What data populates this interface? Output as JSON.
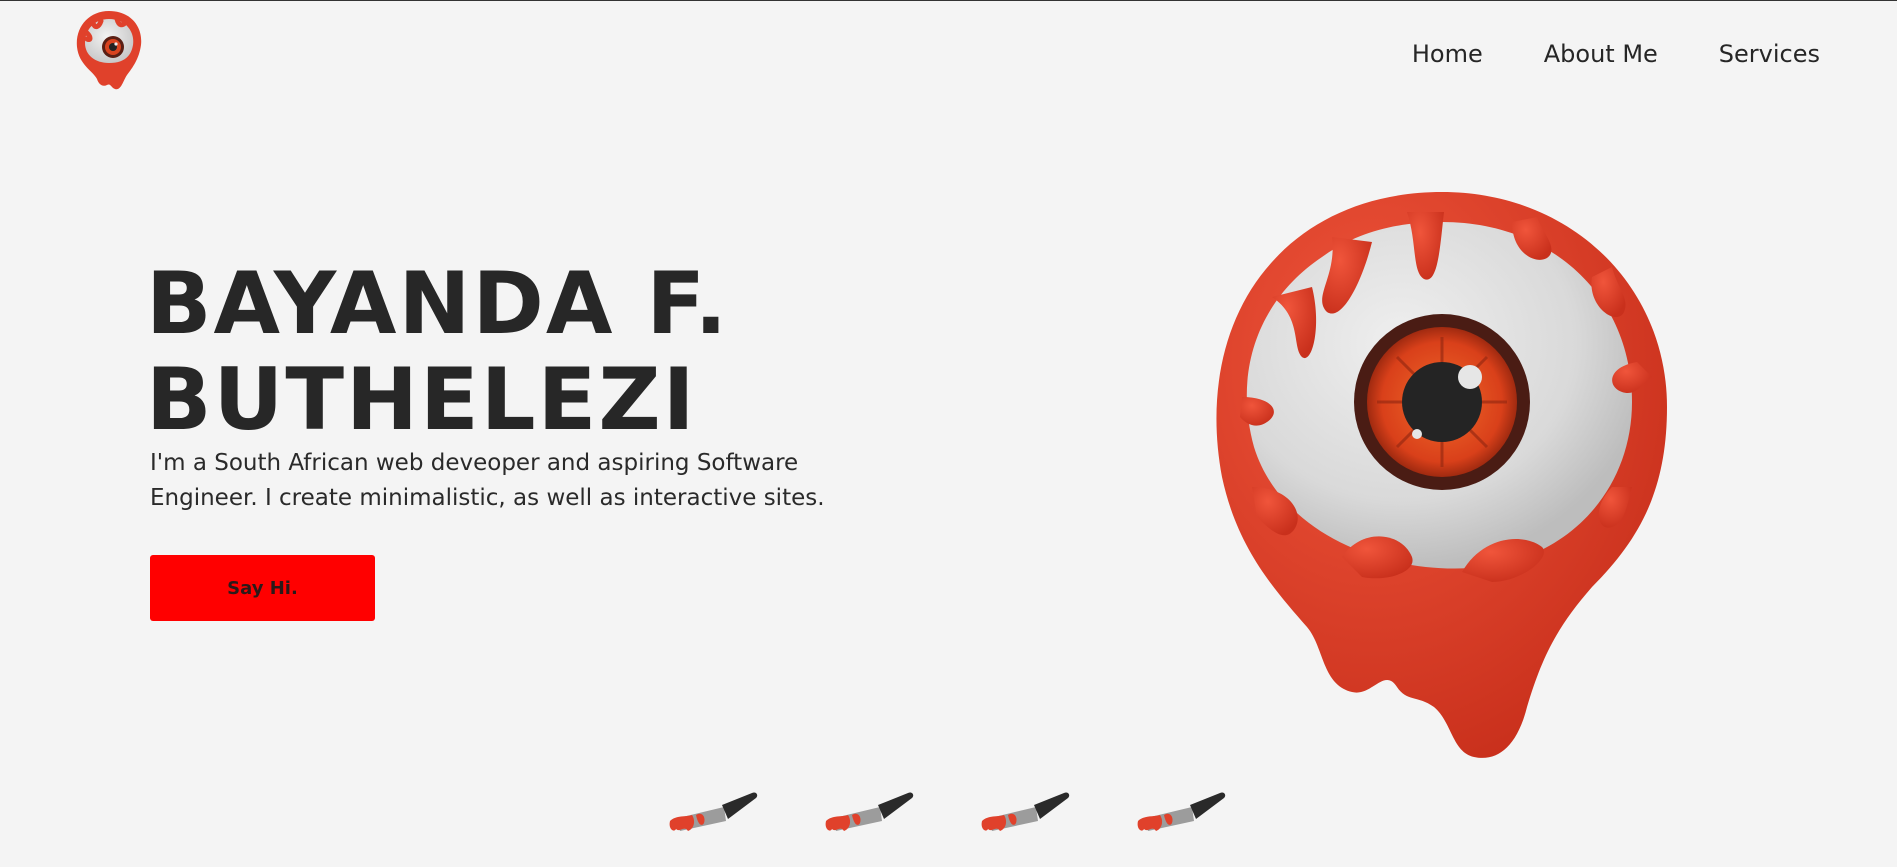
{
  "header": {
    "logo_icon": "bloody-eyeball-icon",
    "nav": [
      {
        "label": "Home"
      },
      {
        "label": "About Me"
      },
      {
        "label": "Services"
      }
    ]
  },
  "hero": {
    "title_line1": "BAYANDA F.",
    "title_line2": "BUTHELEZI",
    "description": "I'm a South African web deveoper and aspiring Software Engineer. I create minimalistic, as well as interactive sites.",
    "cta_label": "Say Hi.",
    "illustration_icon": "bloody-eyeball-icon"
  },
  "decorations": {
    "knife_icon": "bloody-knife-icon"
  },
  "colors": {
    "background": "#f4f4f4",
    "accent": "#ff0000",
    "text": "#262626",
    "blood": "#e0412b"
  }
}
